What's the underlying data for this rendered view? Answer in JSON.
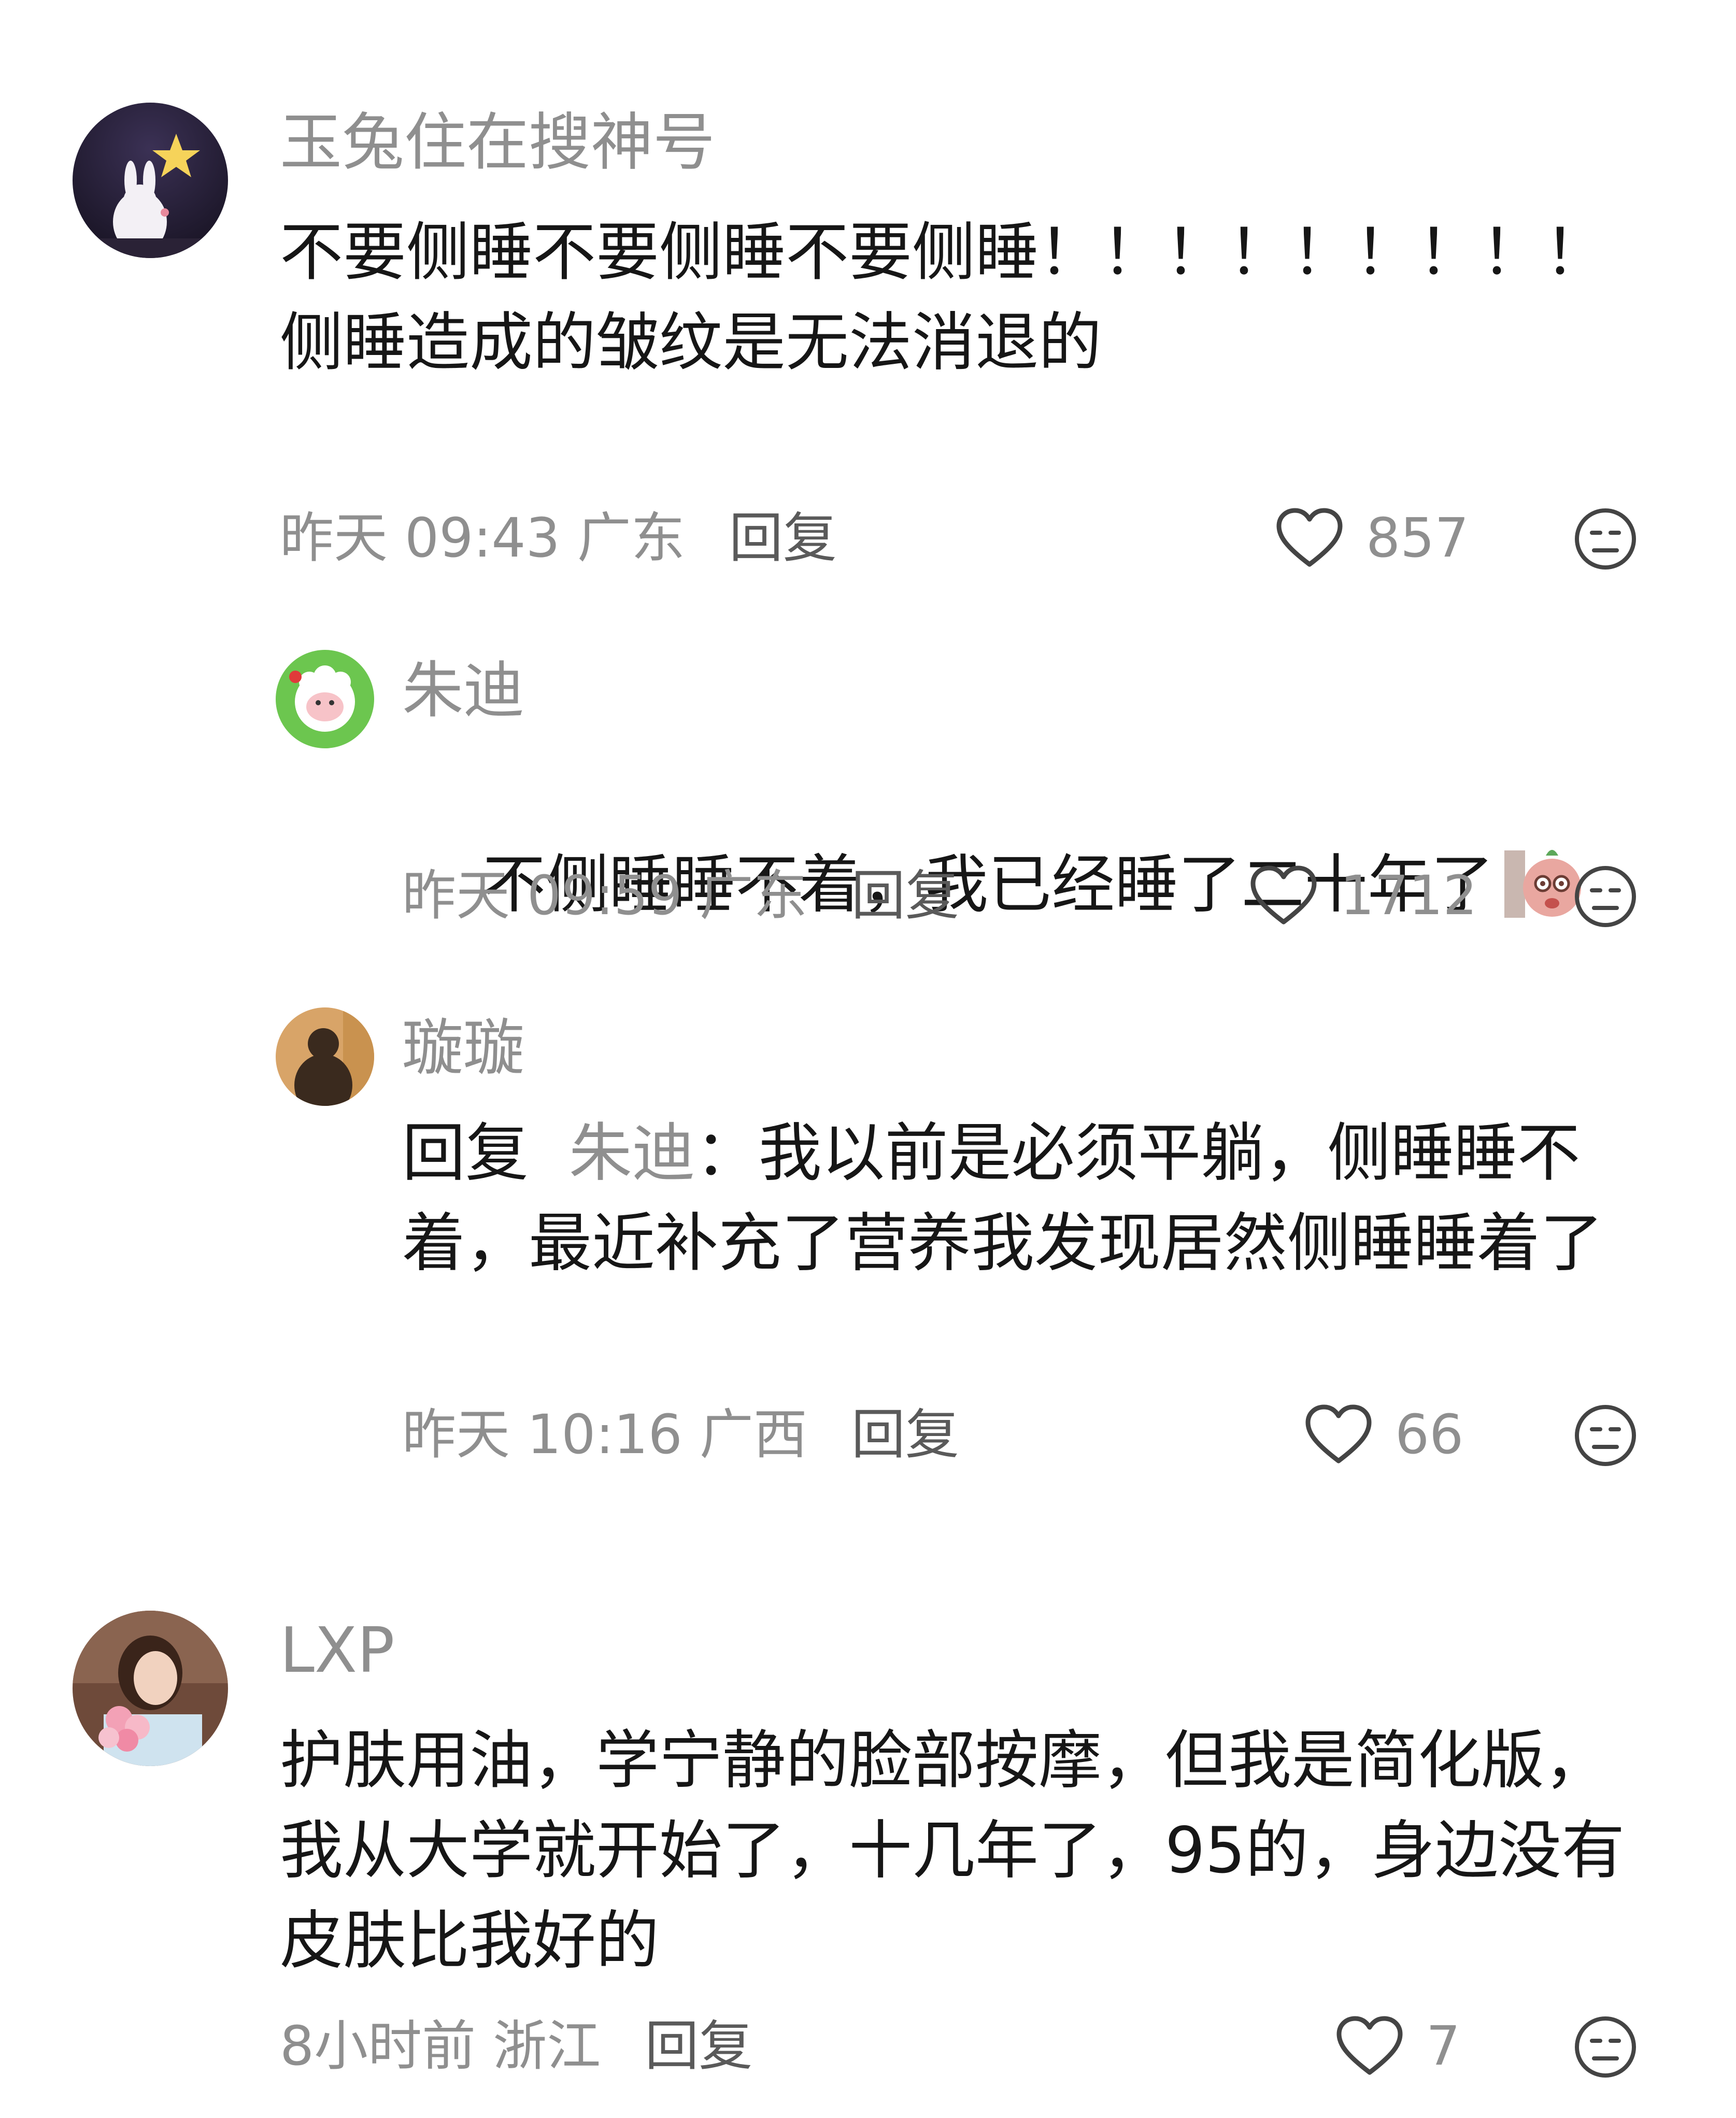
{
  "comments": [
    {
      "author": "玉兔住在搜神号",
      "text": "不要侧睡不要侧睡不要侧睡！！！！！！！！！侧睡造成的皱纹是无法消退的",
      "time": "昨天 09:43",
      "location": "广东",
      "reply_label": "回复",
      "likes": "857",
      "replies": [
        {
          "author": "朱迪",
          "text": "不侧睡睡不着，我已经睡了二十年了",
          "emoji": "peeking-emoji",
          "time": "昨天 09:59",
          "location": "广东",
          "reply_label": "回复",
          "likes": "1712"
        },
        {
          "author": "璇璇",
          "reply_prefix": "回复",
          "reply_target": "朱迪",
          "text": "我以前是必须平躺，侧睡睡不着，最近补充了营养我发现居然侧睡睡着了",
          "time": "昨天 10:16",
          "location": "广西",
          "reply_label": "回复",
          "likes": "66"
        }
      ]
    },
    {
      "author": "LXP",
      "text": "护肤用油，学宁静的脸部按摩，但我是简化版，我从大学就开始了，十几年了，95的，身边没有皮肤比我好的",
      "time": "8小时前",
      "location": "浙江",
      "reply_label": "回复",
      "likes": "7"
    }
  ],
  "icons": {
    "like": "heart-outline-icon",
    "dislike": "meh-face-icon"
  },
  "colors": {
    "text": "#161616",
    "secondary": "#8f8f8f"
  }
}
